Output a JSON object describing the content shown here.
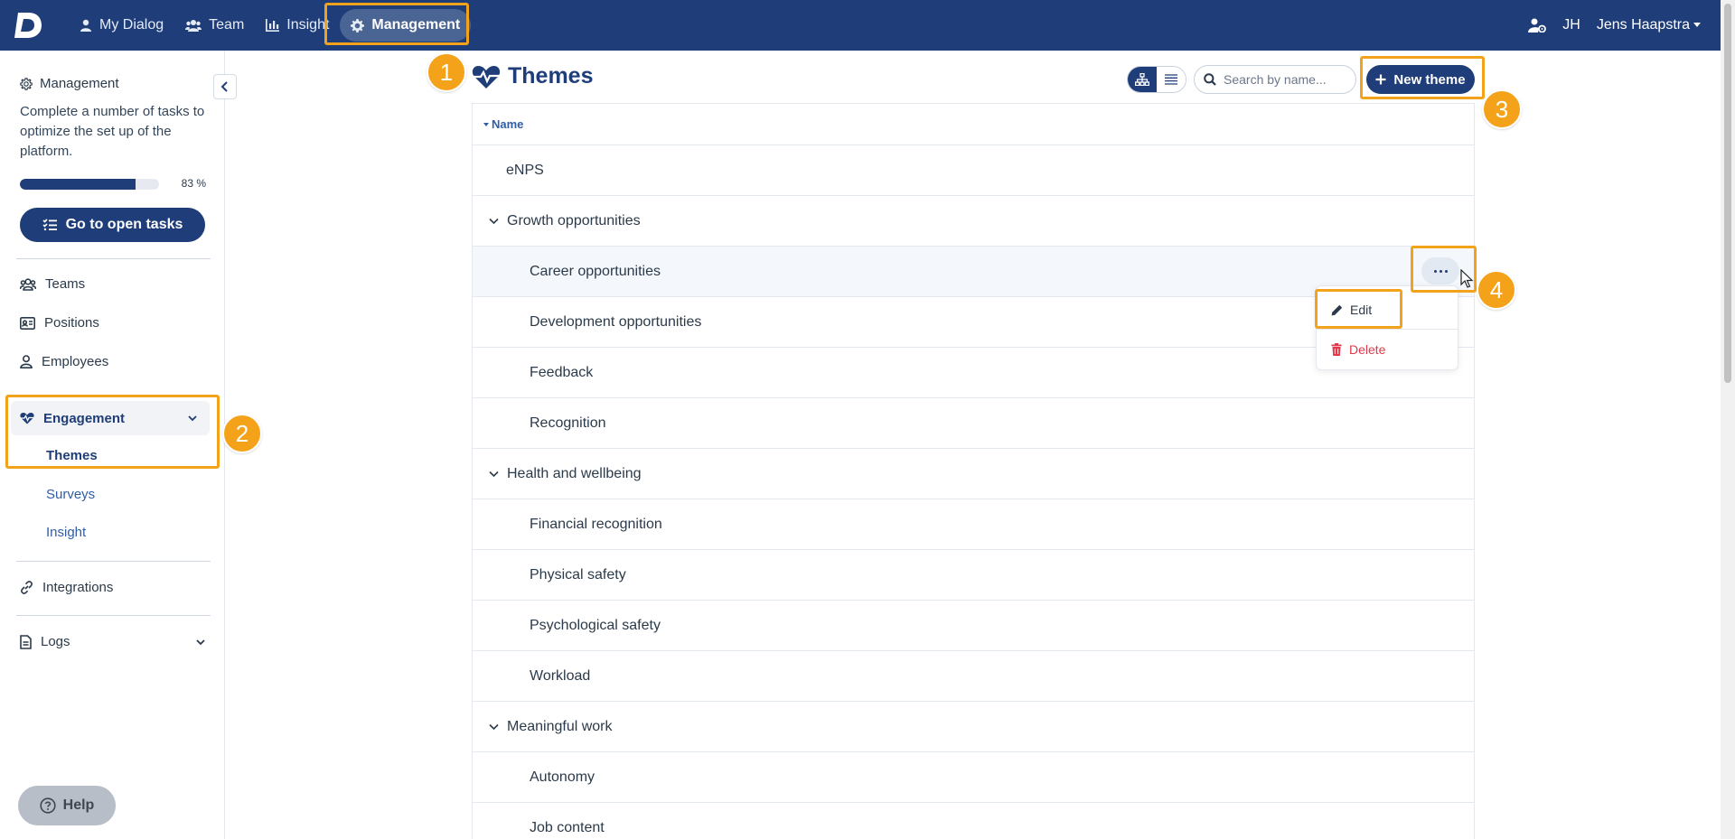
{
  "topnav": {
    "logo_letter": "D",
    "items": [
      {
        "label": "My Dialog",
        "icon": "user-icon"
      },
      {
        "label": "Team",
        "icon": "users-icon"
      },
      {
        "label": "Insight",
        "icon": "chart-icon"
      },
      {
        "label": "Management",
        "icon": "gear-icon",
        "active": true
      }
    ],
    "user_initials": "JH",
    "user_name": "Jens Haapstra"
  },
  "sidebar": {
    "section_title": "Management",
    "description": "Complete a number of tasks to optimize the set up of the platform.",
    "progress_value": 0.83,
    "progress_label": "83 %",
    "open_tasks_label": "Go to open tasks",
    "links": [
      {
        "label": "Teams",
        "icon": "users-icon"
      },
      {
        "label": "Positions",
        "icon": "id-card-icon"
      },
      {
        "label": "Employees",
        "icon": "user-icon"
      }
    ],
    "engagement": {
      "label": "Engagement",
      "sub_items": [
        {
          "label": "Themes",
          "active": true
        },
        {
          "label": "Surveys"
        },
        {
          "label": "Insight"
        }
      ]
    },
    "integrations_label": "Integrations",
    "logs_label": "Logs",
    "help_label": "Help"
  },
  "main": {
    "title": "Themes",
    "search_placeholder": "Search by name...",
    "new_theme_label": "New theme",
    "column_header": "Name",
    "rows": [
      {
        "label": "eNPS",
        "level": 0,
        "group": false
      },
      {
        "label": "Growth opportunities",
        "level": 0,
        "group": true
      },
      {
        "label": "Career opportunities",
        "level": 1,
        "group": false,
        "hover": true
      },
      {
        "label": "Development opportunities",
        "level": 1,
        "group": false
      },
      {
        "label": "Feedback",
        "level": 1,
        "group": false
      },
      {
        "label": "Recognition",
        "level": 1,
        "group": false
      },
      {
        "label": "Health and wellbeing",
        "level": 0,
        "group": true
      },
      {
        "label": "Financial recognition",
        "level": 1,
        "group": false
      },
      {
        "label": "Physical safety",
        "level": 1,
        "group": false
      },
      {
        "label": "Psychological safety",
        "level": 1,
        "group": false
      },
      {
        "label": "Workload",
        "level": 1,
        "group": false
      },
      {
        "label": "Meaningful work",
        "level": 0,
        "group": true
      },
      {
        "label": "Autonomy",
        "level": 1,
        "group": false
      },
      {
        "label": "Job content",
        "level": 1,
        "group": false
      }
    ],
    "row_menu": {
      "edit_label": "Edit",
      "delete_label": "Delete"
    }
  },
  "annotations": [
    "1",
    "2",
    "3",
    "4"
  ],
  "colors": {
    "brand": "#1f3d78",
    "highlight": "#f2a21b",
    "danger": "#e0384a"
  }
}
